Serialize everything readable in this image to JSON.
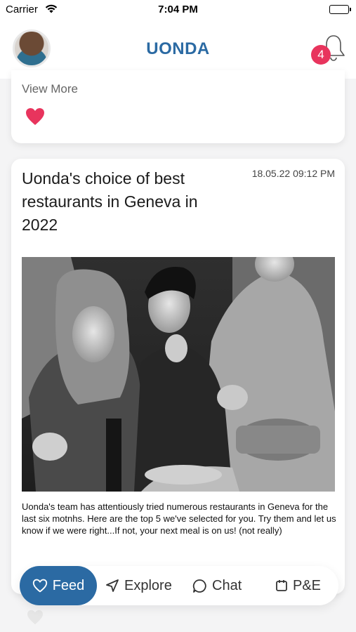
{
  "status_bar": {
    "carrier": "Carrier",
    "time": "7:04 PM"
  },
  "header": {
    "title": "UONDA",
    "notification_count": "4"
  },
  "previous_card": {
    "view_more": "View More",
    "liked_color": "#e8345d"
  },
  "post": {
    "title": "Uonda's choice of best restaurants in Geneva in 2022",
    "timestamp": "18.05.22 09:12 PM",
    "body": "Uonda's team has attentiously tried numerous restaurants in Geneva for the last six motnhs. Here are the top 5 we've selected for you. Try them and let us know if we were right...If not, your next meal is on us! (not really)"
  },
  "tabs": [
    {
      "label": "Feed",
      "icon": "heart-icon",
      "active": true
    },
    {
      "label": "Explore",
      "icon": "navigation-arrow-icon"
    },
    {
      "label": "Chat",
      "icon": "chat-bubble-icon"
    },
    {
      "label": "P&E",
      "icon": "calendar-icon"
    }
  ],
  "colors": {
    "brand": "#2b6aa3",
    "accent": "#e8345d",
    "background": "#f4f4f5"
  }
}
